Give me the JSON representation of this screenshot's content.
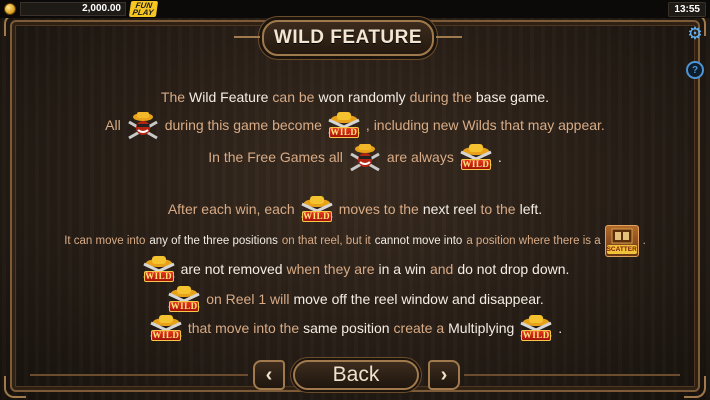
{
  "topbar": {
    "balance": "2,000.00",
    "mode_badge_line1": "FUN",
    "mode_badge_line2": "PLAY",
    "clock": "13:55"
  },
  "title": "WILD FEATURE",
  "icons": {
    "settings": "gear-icon",
    "help": "help-icon",
    "wild_symbol_label": "WILD",
    "scatter_symbol_label": "SCATTER"
  },
  "lines": {
    "l1": {
      "a": "The",
      "b": "Wild Feature",
      "c": "can be",
      "d": "won randomly",
      "e": "during the",
      "f": "base game."
    },
    "l2": {
      "a": "All",
      "b": "during this game become",
      "c": ", including new Wilds that may appear."
    },
    "l3": {
      "a": "In the Free Games all",
      "b": "are always",
      "c": "."
    },
    "l4": {
      "a": "After each win, each",
      "b": "moves to the",
      "c": "next reel",
      "d": "to the",
      "e": "left."
    },
    "l5": {
      "a": "It can move into",
      "b": "any of the three positions",
      "c": "on that reel, but it",
      "d": "cannot move into",
      "e": "a position where there is a",
      "f": "."
    },
    "l6": {
      "a": "are not removed",
      "b": "when they are",
      "c": "in a win",
      "d": "and",
      "e": "do not drop down."
    },
    "l7": {
      "a": "on Reel 1 will",
      "b": "move off the reel window and disappear."
    },
    "l8": {
      "a": "that move into the",
      "b": "same position",
      "c": "create a",
      "d": "Multiplying",
      "e": "."
    }
  },
  "nav": {
    "prev": "‹",
    "back": "Back",
    "next": "›"
  },
  "colors": {
    "body_text": "#d8ab86",
    "highlight_text": "#f3ede4",
    "frame": "#a07a4c",
    "wild_label_bg": "#c2200e",
    "wild_label_text": "#ffe47a"
  }
}
